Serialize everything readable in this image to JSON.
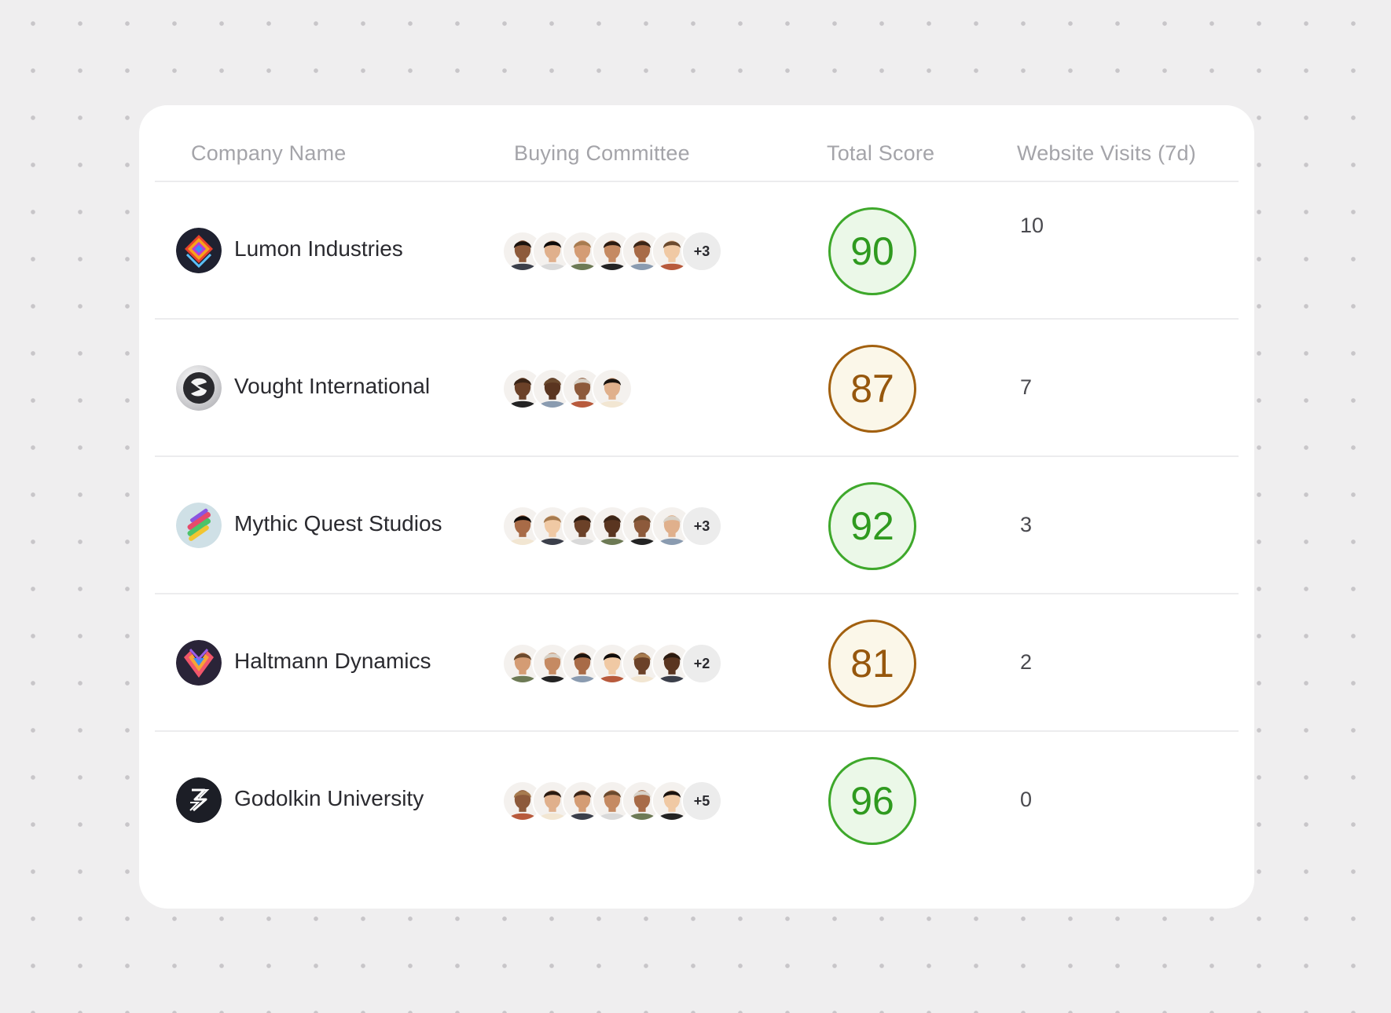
{
  "table": {
    "headers": {
      "company": "Company Name",
      "committee": "Buying Committee",
      "score": "Total Score",
      "visits": "Website Visits (7d)"
    },
    "rows": [
      {
        "company": "Lumon Industries",
        "logo_icon": "lumon-logo-icon",
        "avatar_count": 6,
        "more": "+3",
        "score": "90",
        "score_level": "high",
        "visits": "10"
      },
      {
        "company": "Vought International",
        "logo_icon": "vought-logo-icon",
        "avatar_count": 4,
        "more": "",
        "score": "87",
        "score_level": "mid",
        "visits": "7"
      },
      {
        "company": "Mythic Quest Studios",
        "logo_icon": "mythic-quest-logo-icon",
        "avatar_count": 6,
        "more": "+3",
        "score": "92",
        "score_level": "high",
        "visits": "3"
      },
      {
        "company": "Haltmann Dynamics",
        "logo_icon": "haltmann-logo-icon",
        "avatar_count": 6,
        "more": "+2",
        "score": "81",
        "score_level": "mid",
        "visits": "2"
      },
      {
        "company": "Godolkin University",
        "logo_icon": "godolkin-logo-icon",
        "avatar_count": 6,
        "more": "+5",
        "score": "96",
        "score_level": "high",
        "visits": "0"
      }
    ]
  },
  "colors": {
    "score_high_border": "#3ea82b",
    "score_high_fill": "#ebf8e8",
    "score_mid_border": "#a2600f",
    "score_mid_fill": "#fbf7e9"
  }
}
